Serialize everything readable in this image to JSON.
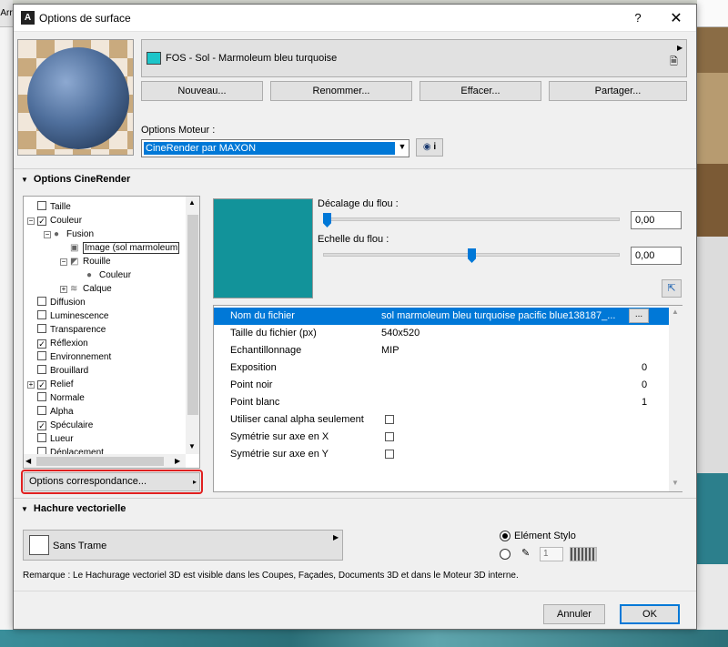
{
  "background": {
    "left_tab_label": "Arr"
  },
  "dialog": {
    "title": "Options de surface",
    "help_label": "?",
    "close_label": "✕"
  },
  "material": {
    "swatch_color": "#1dc5c9",
    "name": "FOS - Sol - Marmoleum bleu turquoise"
  },
  "buttons": {
    "new": "Nouveau...",
    "rename": "Renommer...",
    "delete": "Effacer...",
    "share": "Partager..."
  },
  "engine": {
    "label": "Options Moteur :",
    "selected": "CineRender par MAXON",
    "info_label": "i"
  },
  "cinerender": {
    "header": "Options CineRender",
    "tree": [
      {
        "label": "Taille",
        "checked": false,
        "indent": 1
      },
      {
        "label": "Couleur",
        "checked": true,
        "indent": 1,
        "expander": "−"
      },
      {
        "label": "Fusion",
        "indent": 2,
        "expander": "−",
        "icon": "sphere"
      },
      {
        "label": "Image (sol marmoleum",
        "indent": 3,
        "icon": "image",
        "selected": true
      },
      {
        "label": "Rouille",
        "indent": 3,
        "expander": "−",
        "icon": "rust"
      },
      {
        "label": "Couleur",
        "indent": 4,
        "icon": "sphere"
      },
      {
        "label": "Calque",
        "indent": 3,
        "expander": "+",
        "icon": "layers"
      },
      {
        "label": "Diffusion",
        "checked": false,
        "indent": 1
      },
      {
        "label": "Luminescence",
        "checked": false,
        "indent": 1
      },
      {
        "label": "Transparence",
        "checked": false,
        "indent": 1
      },
      {
        "label": "Réflexion",
        "checked": true,
        "indent": 1
      },
      {
        "label": "Environnement",
        "checked": false,
        "indent": 1
      },
      {
        "label": "Brouillard",
        "checked": false,
        "indent": 1
      },
      {
        "label": "Relief",
        "checked": true,
        "indent": 1,
        "expander": "+"
      },
      {
        "label": "Normale",
        "checked": false,
        "indent": 1
      },
      {
        "label": "Alpha",
        "checked": false,
        "indent": 1
      },
      {
        "label": "Spéculaire",
        "checked": true,
        "indent": 1
      },
      {
        "label": "Lueur",
        "checked": false,
        "indent": 1
      },
      {
        "label": "Déplacement",
        "checked": false,
        "indent": 1
      }
    ],
    "correspondence_button": "Options correspondance...",
    "blur_offset": {
      "label": "Décalage du flou :",
      "value": "0,00",
      "level": 0.0
    },
    "blur_scale": {
      "label": "Echelle du flou :",
      "value": "0,00",
      "level": 0.5
    },
    "texture_color": "#12939a",
    "properties": [
      {
        "key": "Nom du fichier",
        "value": "sol marmoleum bleu turquoise pacific blue138187_...",
        "selected": true,
        "button": "..."
      },
      {
        "key": "Taille du fichier (px)",
        "value": "540x520"
      },
      {
        "key": "Echantillonnage",
        "value": "MIP"
      },
      {
        "key": "Exposition",
        "number": "0"
      },
      {
        "key": "Point noir",
        "number": "0"
      },
      {
        "key": "Point blanc",
        "number": "1"
      },
      {
        "key": "Utiliser canal alpha seulement",
        "checkbox": true
      },
      {
        "key": "Symétrie sur axe en X",
        "checkbox": true
      },
      {
        "key": "Symétrie sur axe en Y",
        "checkbox": true
      }
    ]
  },
  "vector_hatch": {
    "header": "Hachure vectorielle",
    "fill_name": "Sans Trame",
    "radio_pen_label": "Elément Stylo",
    "pen_number": "1",
    "remark": "Remarque : Le Hachurage vectoriel 3D est visible dans les Coupes, Façades, Documents 3D et dans le Moteur 3D interne."
  },
  "footer": {
    "cancel": "Annuler",
    "ok": "OK"
  }
}
